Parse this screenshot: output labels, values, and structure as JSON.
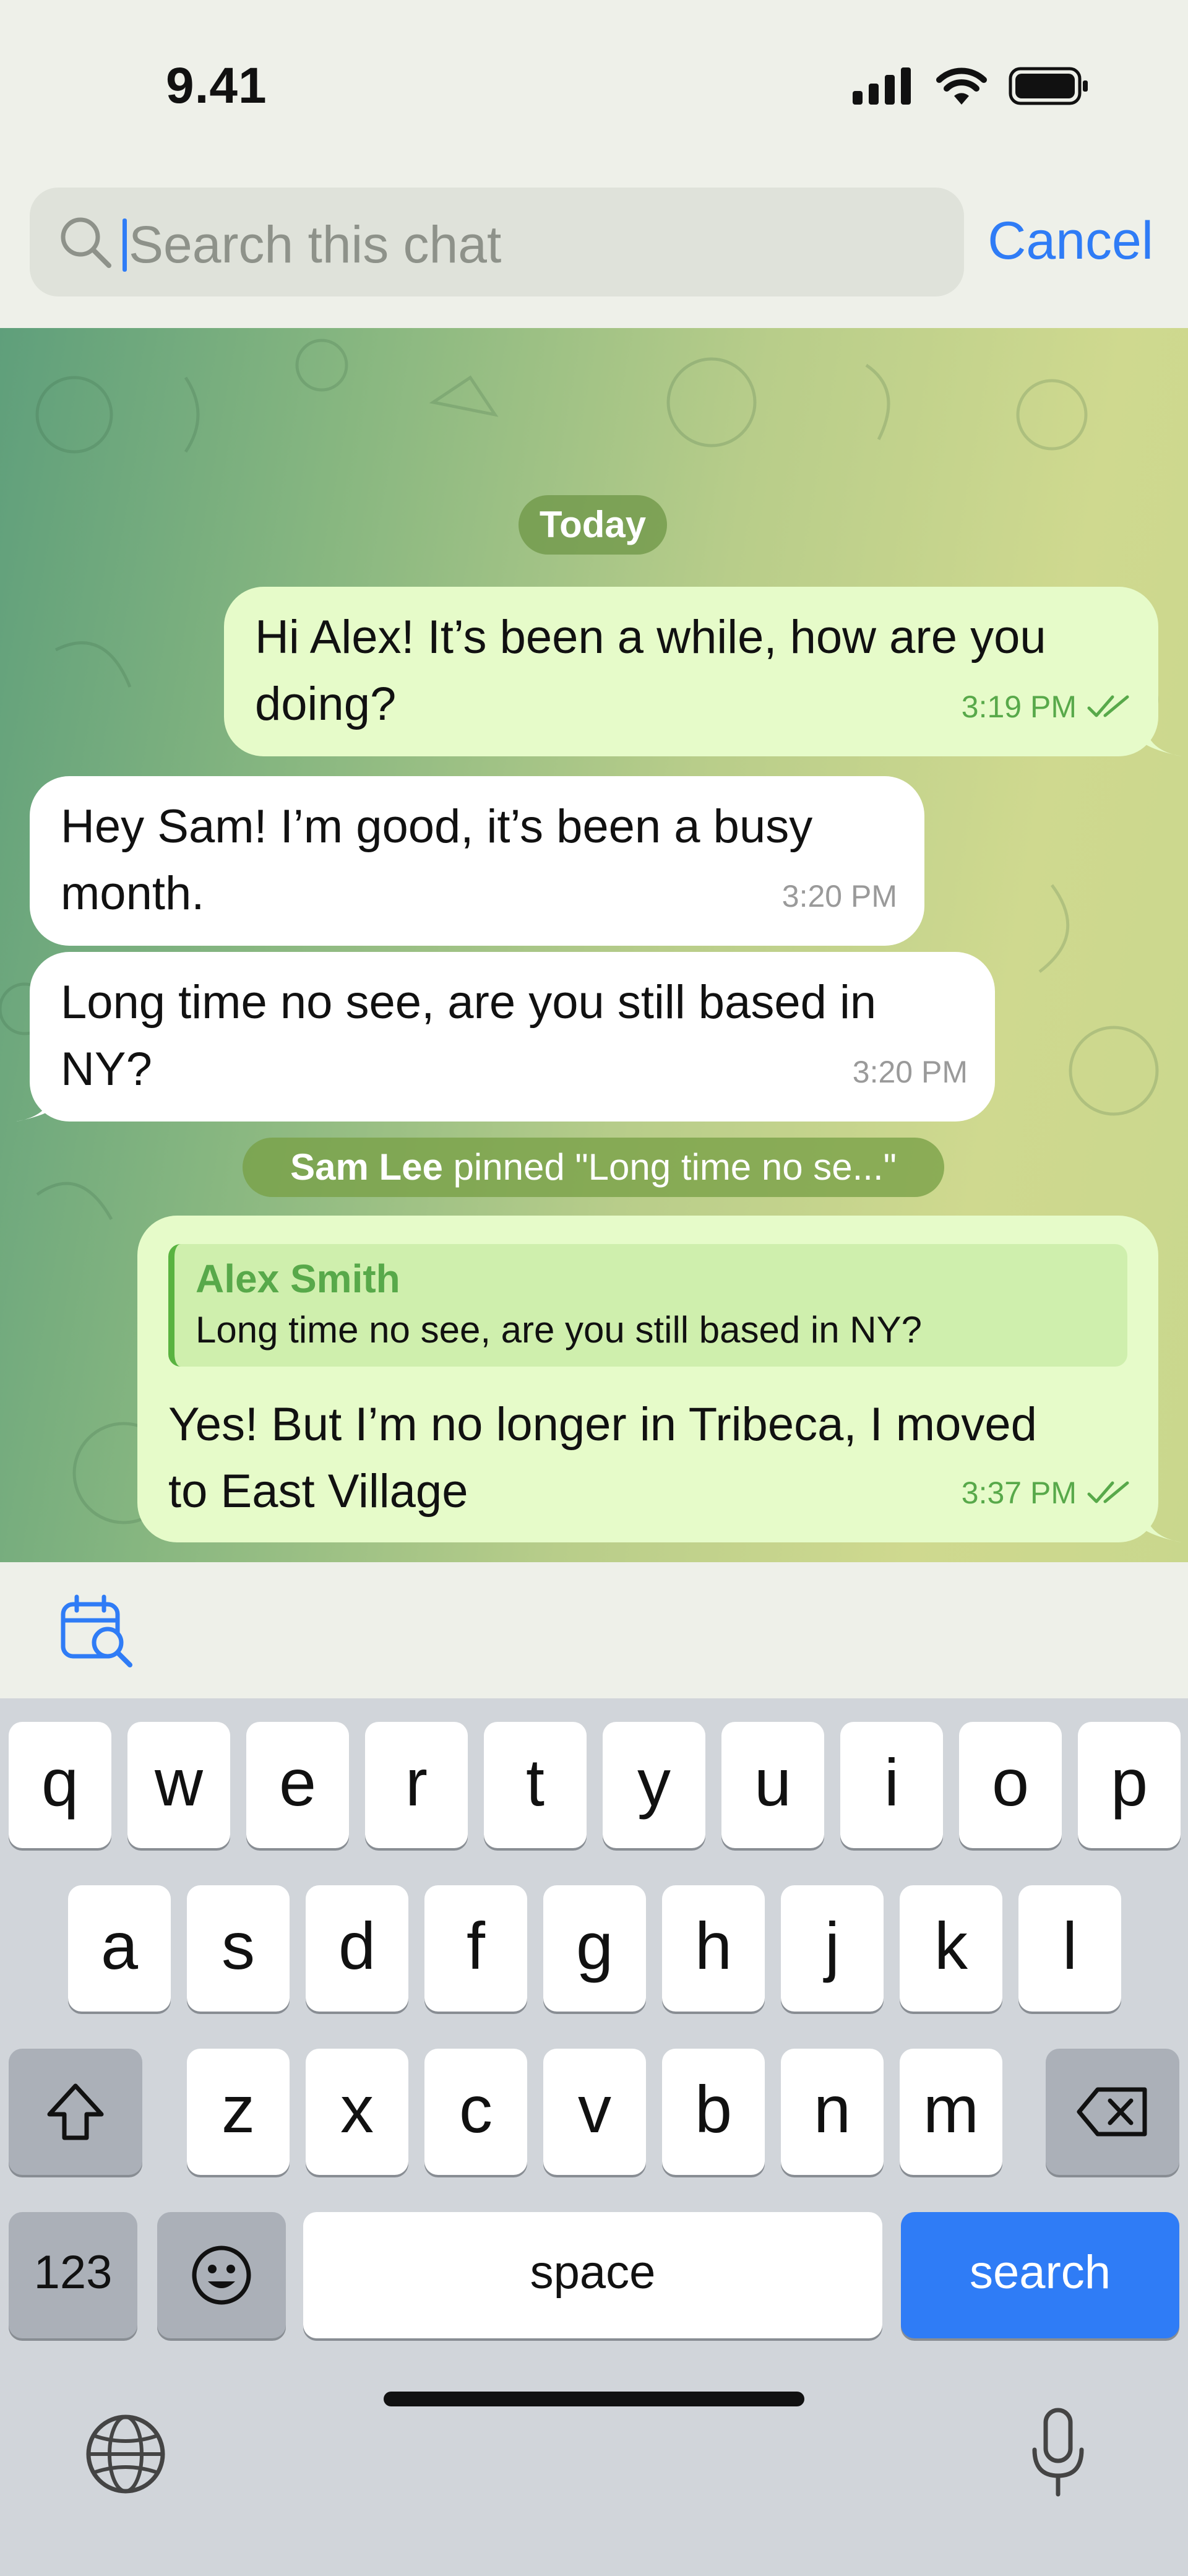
{
  "status_bar": {
    "time": "9.41"
  },
  "search": {
    "placeholder": "Search this chat",
    "cancel_label": "Cancel"
  },
  "chat": {
    "date_label": "Today",
    "messages": [
      {
        "direction": "out",
        "lines": [
          "Hi Alex! It’s been a while, how are you",
          "doing?"
        ],
        "time": "3:19 PM",
        "read": true
      },
      {
        "direction": "in",
        "lines": [
          "Hey Sam! I’m good, it’s been a busy",
          "month."
        ],
        "time": "3:20 PM"
      },
      {
        "direction": "in",
        "lines": [
          "Long time no see, are you still based in",
          "NY?"
        ],
        "time": "3:20 PM"
      },
      {
        "direction": "out",
        "reply": {
          "name": "Alex Smith",
          "text": "Long time no see, are you still based in NY?"
        },
        "lines": [
          "Yes! But I’m no longer in Tribeca, I moved",
          "to East Village"
        ],
        "time": "3:37 PM",
        "read": true
      }
    ],
    "service_message": {
      "actor": "Sam Lee",
      "text": " pinned \"Long time no se...\""
    }
  },
  "toolbar": {
    "calendar_icon": "calendar-search-icon"
  },
  "keyboard": {
    "row1": [
      "q",
      "w",
      "e",
      "r",
      "t",
      "y",
      "u",
      "i",
      "o",
      "p"
    ],
    "row2": [
      "a",
      "s",
      "d",
      "f",
      "g",
      "h",
      "j",
      "k",
      "l"
    ],
    "row3": [
      "z",
      "x",
      "c",
      "v",
      "b",
      "n",
      "m"
    ],
    "numbers_label": "123",
    "space_label": "space",
    "search_label": "search"
  },
  "colors": {
    "accent": "#2f7cf6",
    "outgoing_bubble": "#e6fbc9",
    "incoming_bubble": "#ffffff",
    "check_green": "#58a94a"
  }
}
